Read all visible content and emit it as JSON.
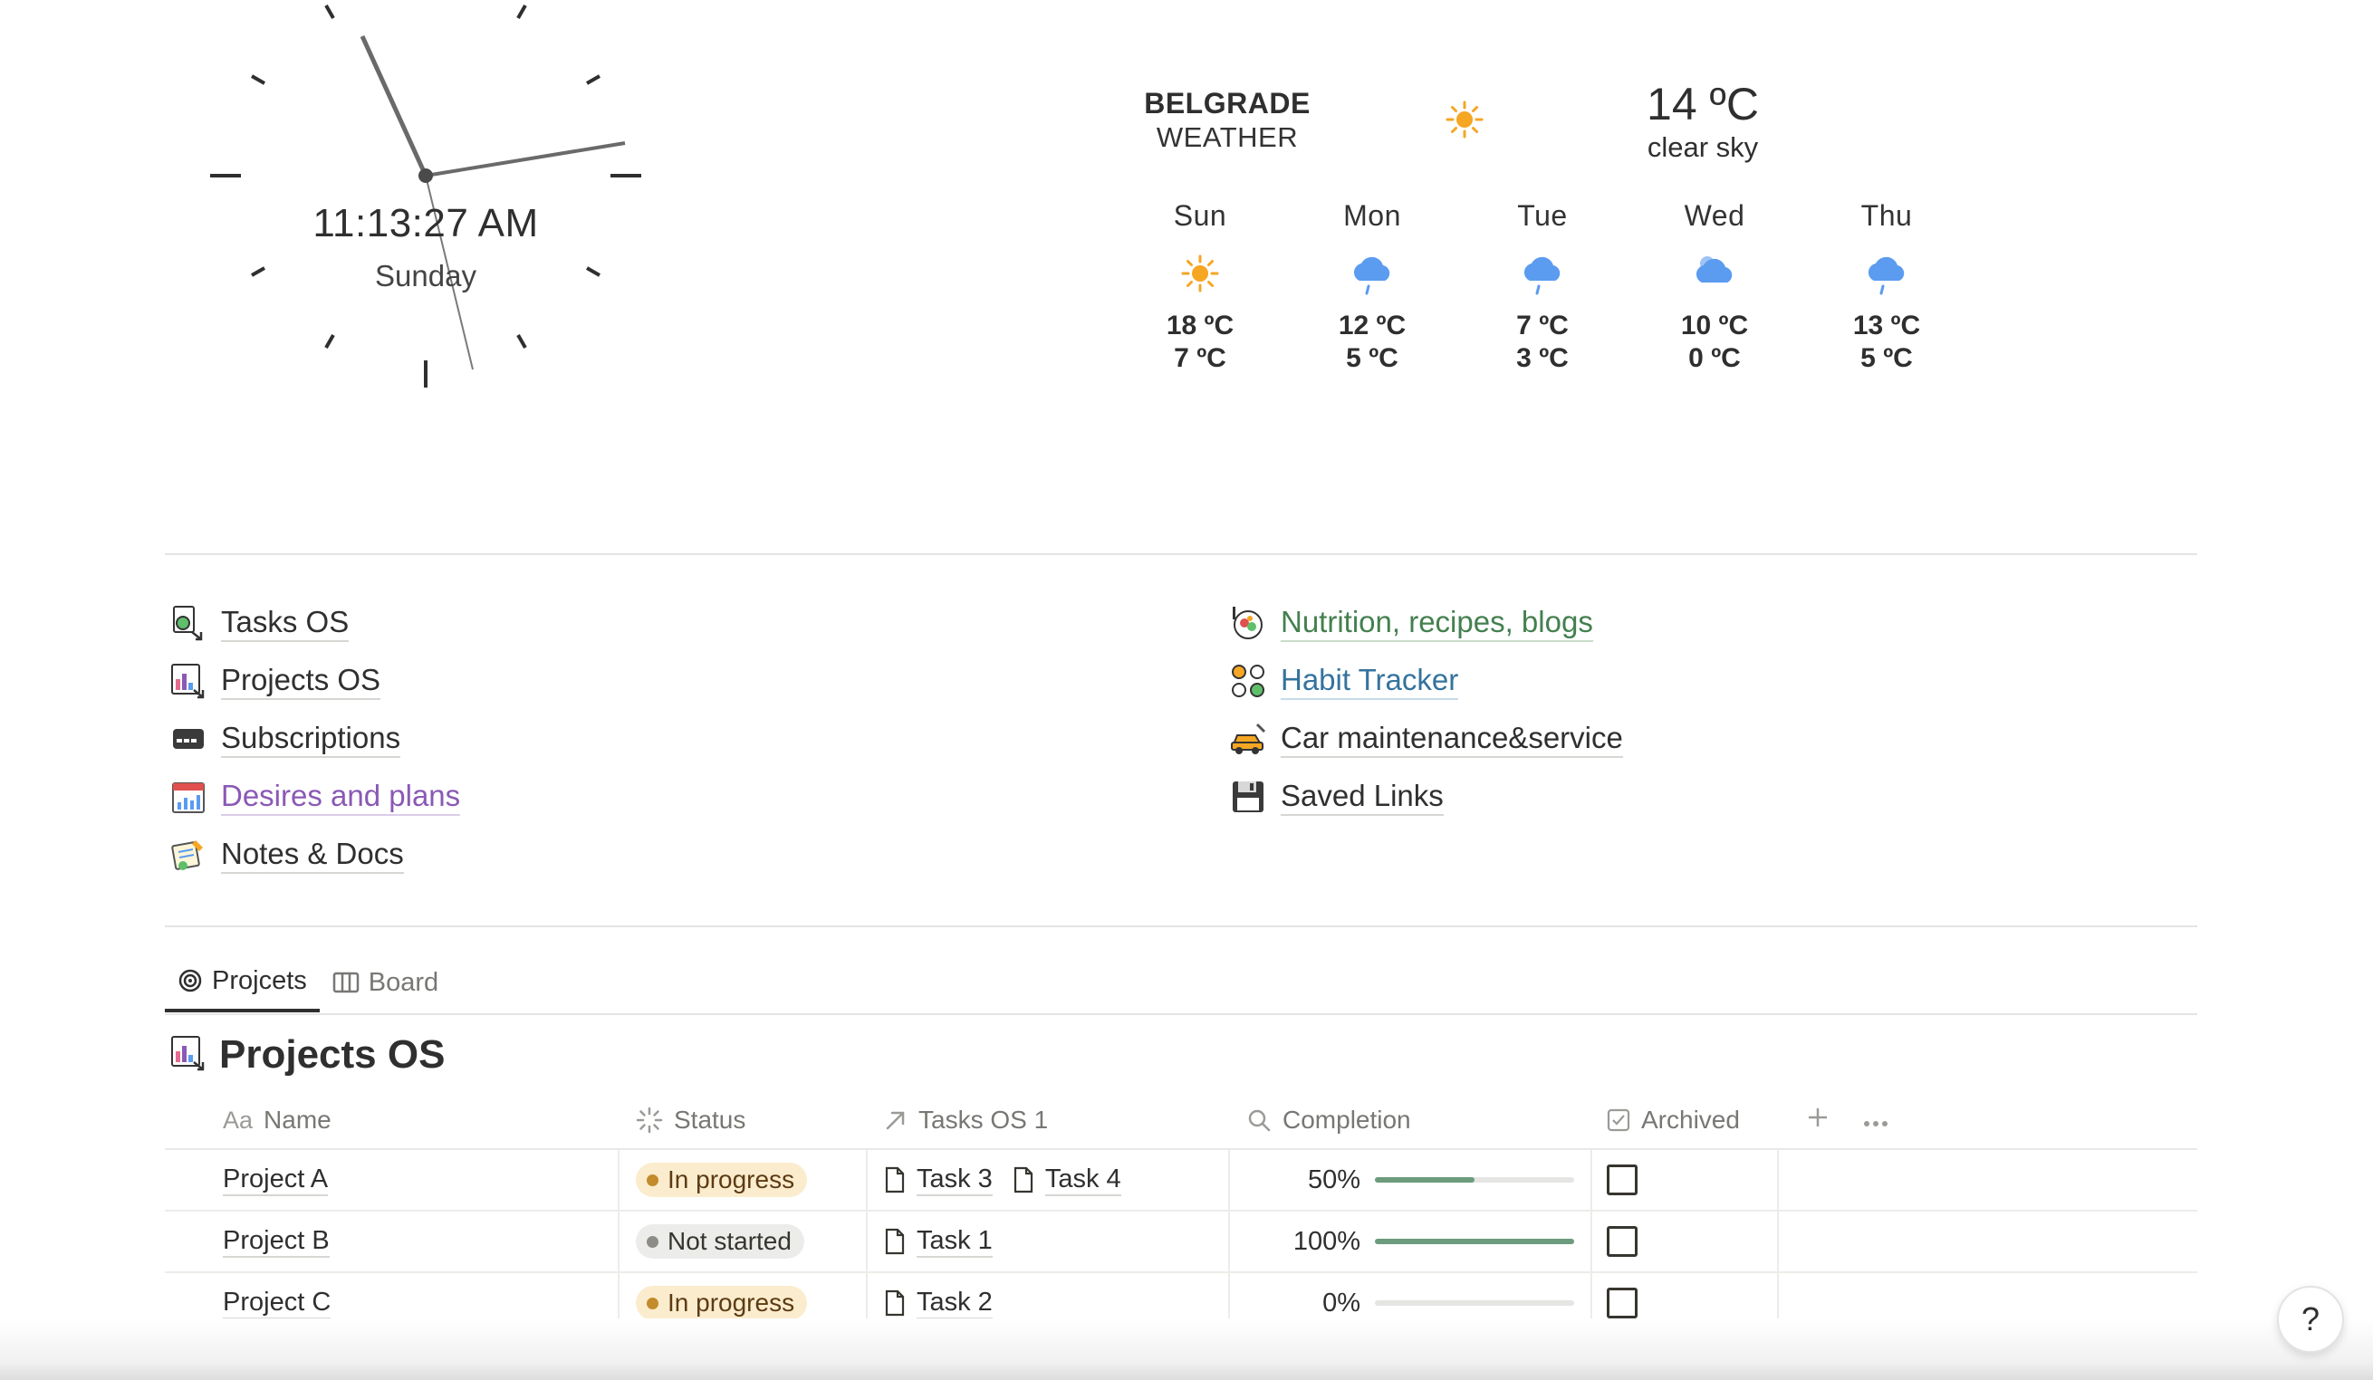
{
  "clock": {
    "time": "11:13:27 AM",
    "day": "Sunday"
  },
  "weather": {
    "city": "BELGRADE",
    "label": "WEATHER",
    "current_icon": "sun-icon",
    "current_temp": "14 ºC",
    "current_desc": "clear sky",
    "forecast": [
      {
        "day": "Sun",
        "icon": "sun-icon",
        "hi": "18 ºC",
        "lo": "7 ºC"
      },
      {
        "day": "Mon",
        "icon": "rain-cloud-icon",
        "hi": "12 ºC",
        "lo": "5 ºC"
      },
      {
        "day": "Tue",
        "icon": "rain-cloud-icon",
        "hi": "7 ºC",
        "lo": "3 ºC"
      },
      {
        "day": "Wed",
        "icon": "night-cloud-icon",
        "hi": "10 ºC",
        "lo": "0 ºC"
      },
      {
        "day": "Thu",
        "icon": "rain-cloud-icon",
        "hi": "13 ºC",
        "lo": "5 ºC"
      }
    ],
    "colors": {
      "sun": "#f5a623",
      "cloud": "#5b9bf0"
    }
  },
  "links": {
    "left": [
      {
        "label": "Tasks OS",
        "icon": "tasks-icon"
      },
      {
        "label": "Projects OS",
        "icon": "projects-icon"
      },
      {
        "label": "Subscriptions",
        "icon": "subscriptions-icon"
      },
      {
        "label": "Desires and plans",
        "icon": "calendar-chart-icon"
      },
      {
        "label": "Notes & Docs",
        "icon": "notes-icon"
      }
    ],
    "right": [
      {
        "label": "Nutrition, recipes, blogs",
        "icon": "food-icon"
      },
      {
        "label": "Habit Tracker",
        "icon": "habit-icon"
      },
      {
        "label": "Car maintenance&service",
        "icon": "car-icon"
      },
      {
        "label": "Saved Links",
        "icon": "floppy-icon"
      }
    ],
    "colors": {
      "purple": "#8a59b5",
      "green": "#44804f",
      "blue": "#34739d"
    }
  },
  "tabs": [
    {
      "label": "Projcets",
      "icon": "target-icon",
      "active": true
    },
    {
      "label": "Board",
      "icon": "board-icon",
      "active": false
    }
  ],
  "database": {
    "title": "Projects OS",
    "columns": {
      "name": "Name",
      "name_prefix": "Aa",
      "status": "Status",
      "tasks": "Tasks OS 1",
      "completion": "Completion",
      "archived": "Archived"
    },
    "rows": [
      {
        "name": "Project A",
        "status": "In progress",
        "tasks": [
          "Task 3",
          "Task 4"
        ],
        "completion": "50%",
        "completion_value": 0.5,
        "archived": false
      },
      {
        "name": "Project B",
        "status": "Not started",
        "tasks": [
          "Task 1"
        ],
        "completion": "100%",
        "completion_value": 1.0,
        "archived": false
      },
      {
        "name": "Project C",
        "status": "In progress",
        "tasks": [
          "Task 2"
        ],
        "completion": "0%",
        "completion_value": 0.0,
        "archived": false
      }
    ]
  },
  "help": {
    "label": "?"
  }
}
